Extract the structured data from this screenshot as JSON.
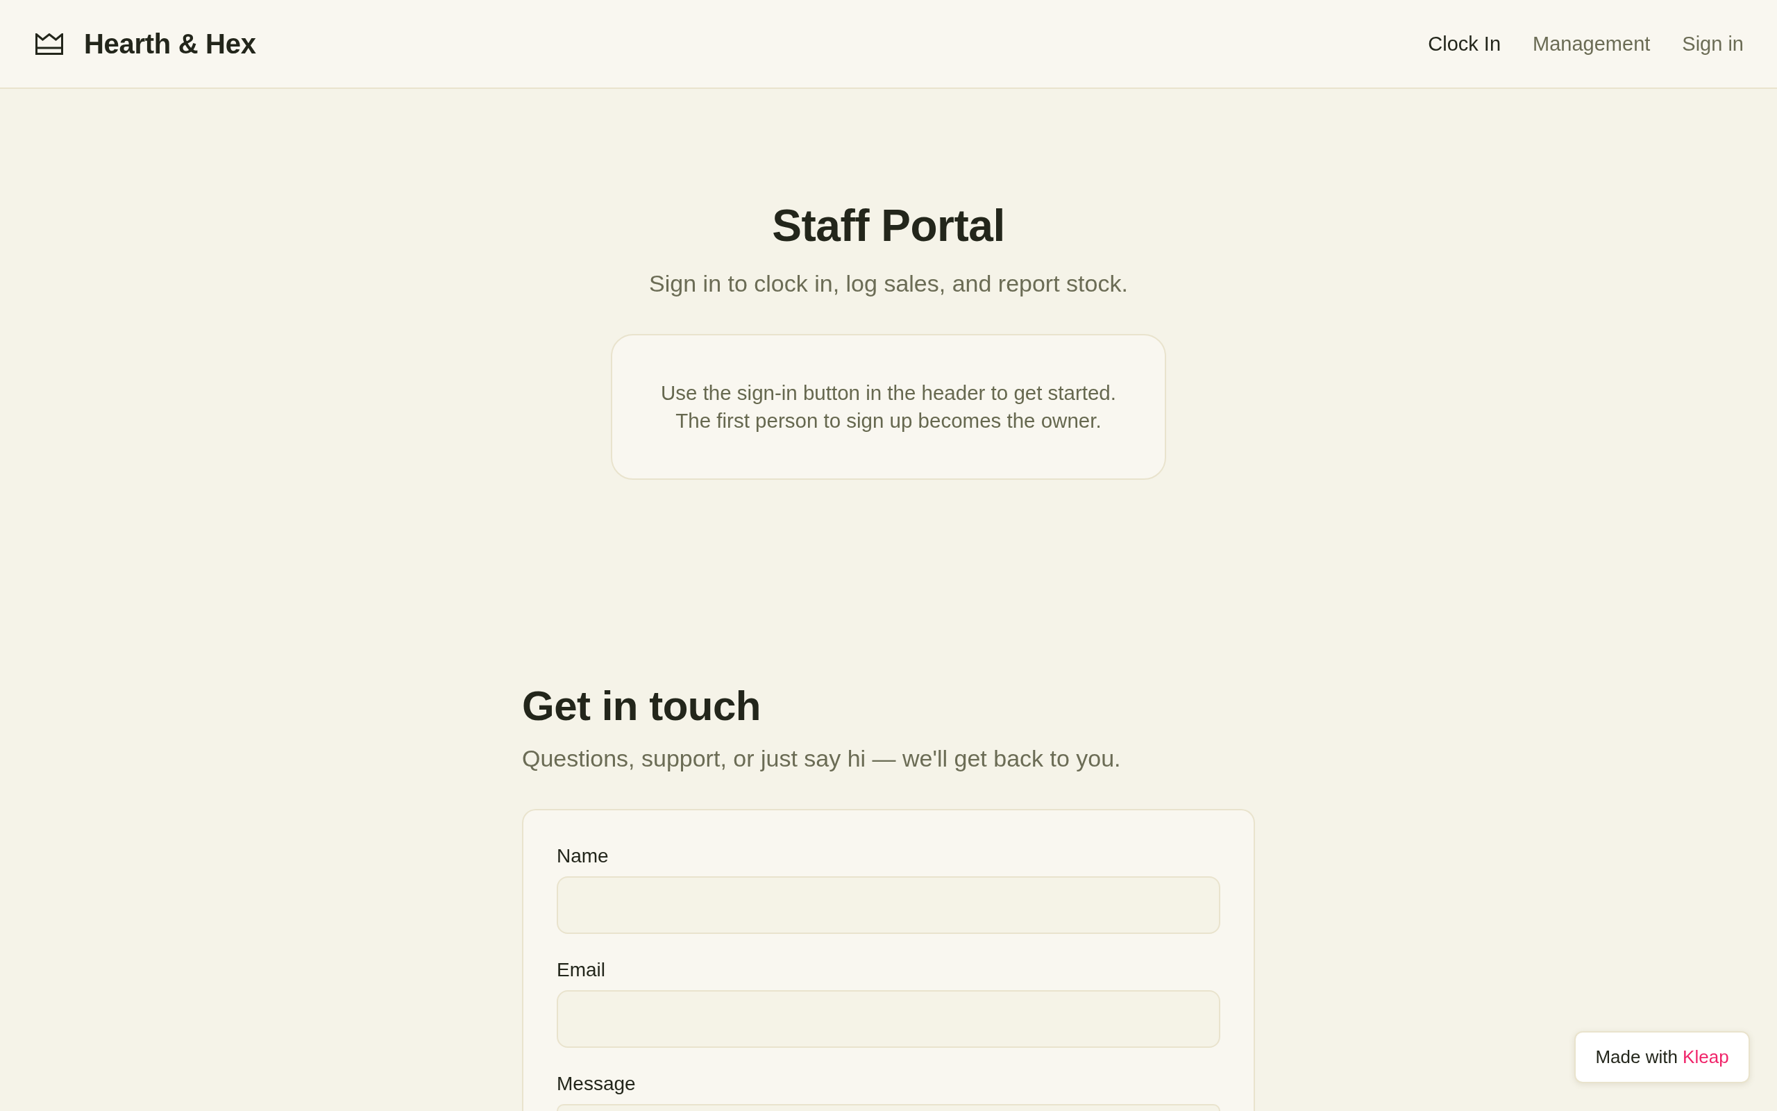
{
  "header": {
    "brand": "Hearth & Hex",
    "nav": [
      {
        "label": "Clock In",
        "selected": true
      },
      {
        "label": "Management",
        "selected": false
      },
      {
        "label": "Sign in",
        "selected": false
      }
    ]
  },
  "portal": {
    "title": "Staff Portal",
    "subtitle": "Sign in to clock in, log sales, and report stock.",
    "notice": {
      "lines": [
        "Use the sign-in button in the header to get started.",
        "The first person to sign up becomes the owner."
      ]
    }
  },
  "contact": {
    "title": "Get in touch",
    "subtitle": "Questions, support, or just say hi — we'll get back to you.",
    "fields": [
      {
        "label": "Name",
        "kind": "input"
      },
      {
        "label": "Email",
        "kind": "input"
      },
      {
        "label": "Message",
        "kind": "textarea"
      }
    ]
  },
  "badge": {
    "text": "Made with",
    "brand": "Kleap"
  }
}
